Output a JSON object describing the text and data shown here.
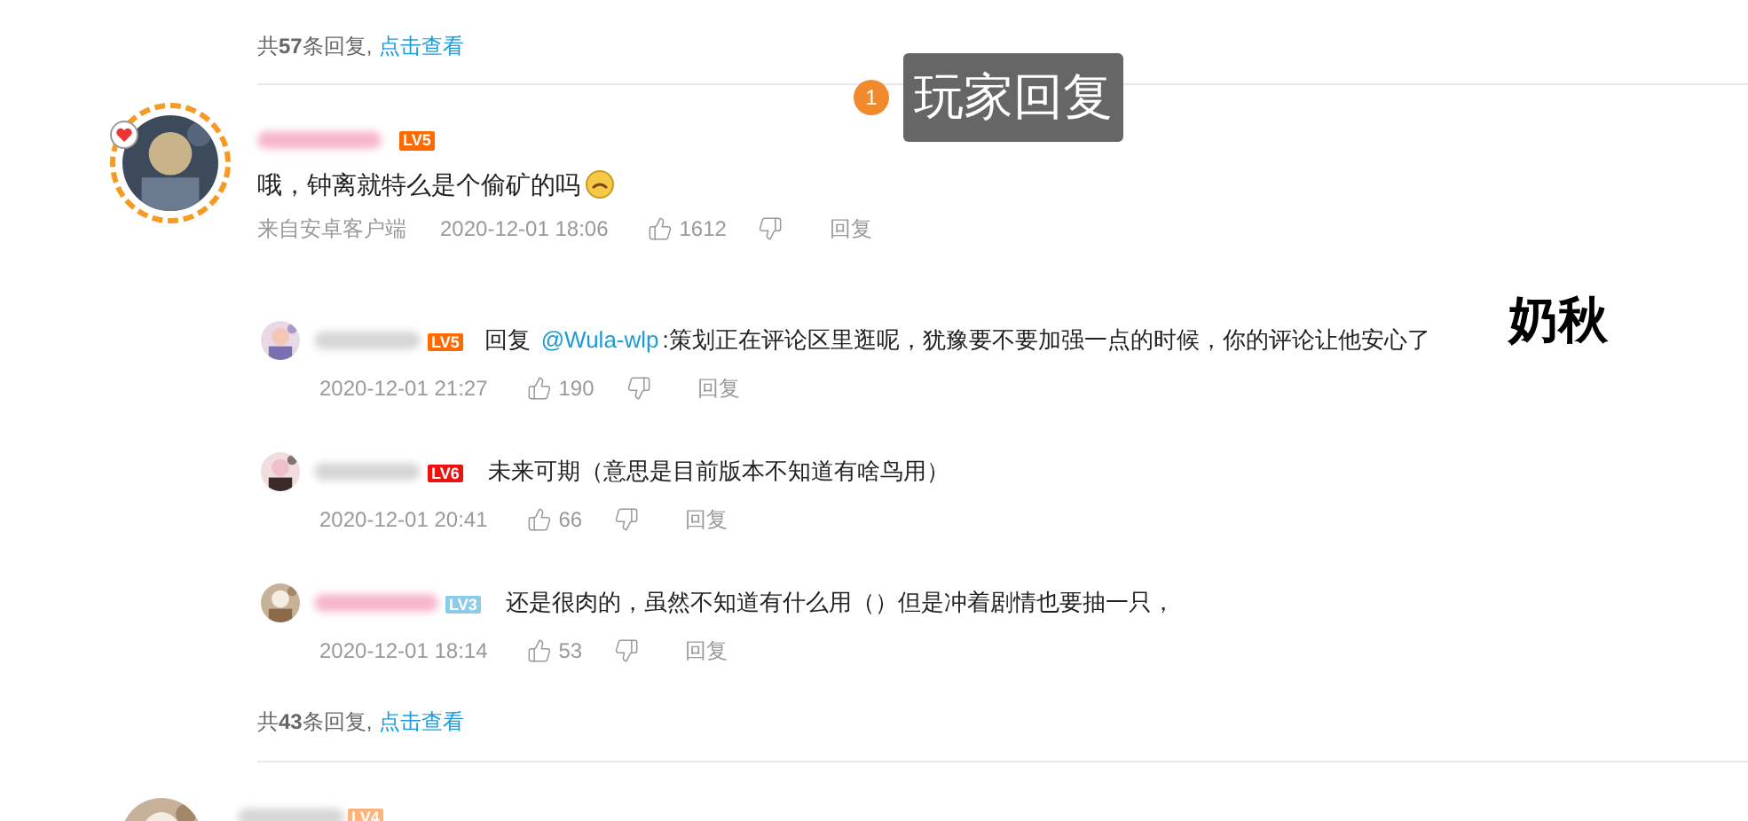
{
  "top_summary": {
    "text": "共**57**条回复,",
    "link": "点击查看"
  },
  "callout": {
    "number": "1",
    "label": "玩家回复"
  },
  "annotation": "奶秋",
  "comments": [
    {
      "badge": {
        "text": "LV5",
        "color": "#ff6a00"
      },
      "text": "哦，钟离就特么是个偷矿的吗",
      "source": "来自安卓客户端",
      "time": "2020-12-01 18:06",
      "likes": "1612",
      "reply_label": "回复",
      "replies": [
        {
          "badge": {
            "text": "LV5",
            "color": "#ff6a00"
          },
          "reply_prefix": "回复",
          "mention": "@Wula-wlp",
          "text": ":策划正在评论区里逛呢，犹豫要不要加强一点的时候，你的评论让他安心了",
          "time": "2020-12-01 21:27",
          "likes": "190",
          "reply_label": "回复"
        },
        {
          "badge": {
            "text": "LV6",
            "color": "#ee1111"
          },
          "text": "未来可期（意思是目前版本不知道有啥鸟用）",
          "time": "2020-12-01 20:41",
          "likes": "66",
          "reply_label": "回复"
        },
        {
          "badge": {
            "text": "LV3",
            "color": "#8ecbe8"
          },
          "text": "还是很肉的，虽然不知道有什么用（）但是冲着剧情也要抽一只，",
          "time": "2020-12-01 18:14",
          "likes": "53",
          "reply_label": "回复"
        }
      ],
      "summary": {
        "text": "共**43**条回复,",
        "link": "点击查看"
      }
    },
    {
      "badge": {
        "text": "LV4",
        "color": "#ffb37a"
      }
    }
  ]
}
